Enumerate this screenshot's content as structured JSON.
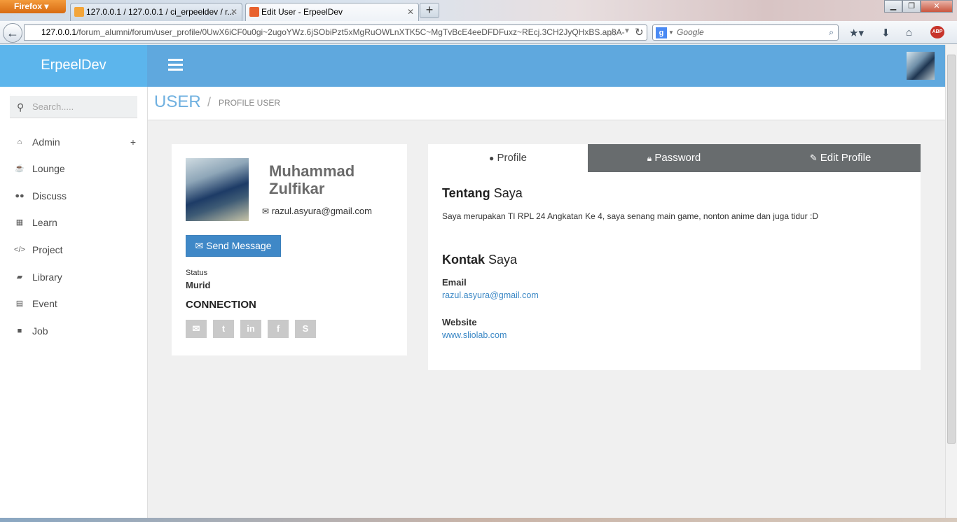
{
  "browser": {
    "menu_label": "Firefox",
    "tabs": [
      {
        "title": "127.0.0.1 / 127.0.0.1 / ci_erpeeldev / r...",
        "active": false
      },
      {
        "title": "Edit User - ErpeelDev",
        "active": true
      }
    ],
    "new_tab": "+",
    "url_host": "127.0.0.1",
    "url_path": "/forum_alumni/forum/user_profile/0UwX6iCF0u0gi~2ugoYWz.6jSObiPzt5xMgRuOWLnXTK5C~MgTvBcE4eeDFDFuxz~REcj.3CH2JyQHxBS.ap8A-",
    "search_placeholder": "Google"
  },
  "app": {
    "brand": "ErpeelDev",
    "search_placeholder": "Search.....",
    "nav": [
      {
        "label": "Admin",
        "icon": "home-icon",
        "has_plus": true
      },
      {
        "label": "Lounge",
        "icon": "coffee-icon"
      },
      {
        "label": "Discuss",
        "icon": "users-icon"
      },
      {
        "label": "Learn",
        "icon": "grid-icon"
      },
      {
        "label": "Project",
        "icon": "code-icon"
      },
      {
        "label": "Library",
        "icon": "book-icon"
      },
      {
        "label": "Event",
        "icon": "calendar-icon"
      },
      {
        "label": "Job",
        "icon": "briefcase-icon"
      }
    ],
    "breadcrumb": {
      "title": "USER",
      "sep": "/",
      "sub": "PROFILE USER"
    }
  },
  "profile": {
    "name": "Muhammad Zulfikar",
    "email": "razul.asyura@gmail.com",
    "send_message": "Send Message",
    "status_label": "Status",
    "status_value": "Murid",
    "connection_title": "CONNECTION",
    "social": [
      "mail-icon",
      "twitter-icon",
      "linkedin-icon",
      "facebook-icon",
      "skype-icon"
    ]
  },
  "tabs": {
    "profile": "Profile",
    "password": "Password",
    "edit": "Edit Profile"
  },
  "about": {
    "title_bold": "Tentang",
    "title_normal": "Saya",
    "text": "Saya merupakan TI RPL 24 Angkatan Ke 4, saya senang main game, nonton anime dan juga tidur :D"
  },
  "contact": {
    "title_bold": "Kontak",
    "title_normal": "Saya",
    "email_label": "Email",
    "email_value": "razul.asyura@gmail.com",
    "website_label": "Website",
    "website_value": "www.sliolab.com"
  },
  "colors": {
    "header": "#5fa8de",
    "brand": "#5cb5ec",
    "button": "#3f88c7",
    "tab_inactive": "#686c6e"
  }
}
